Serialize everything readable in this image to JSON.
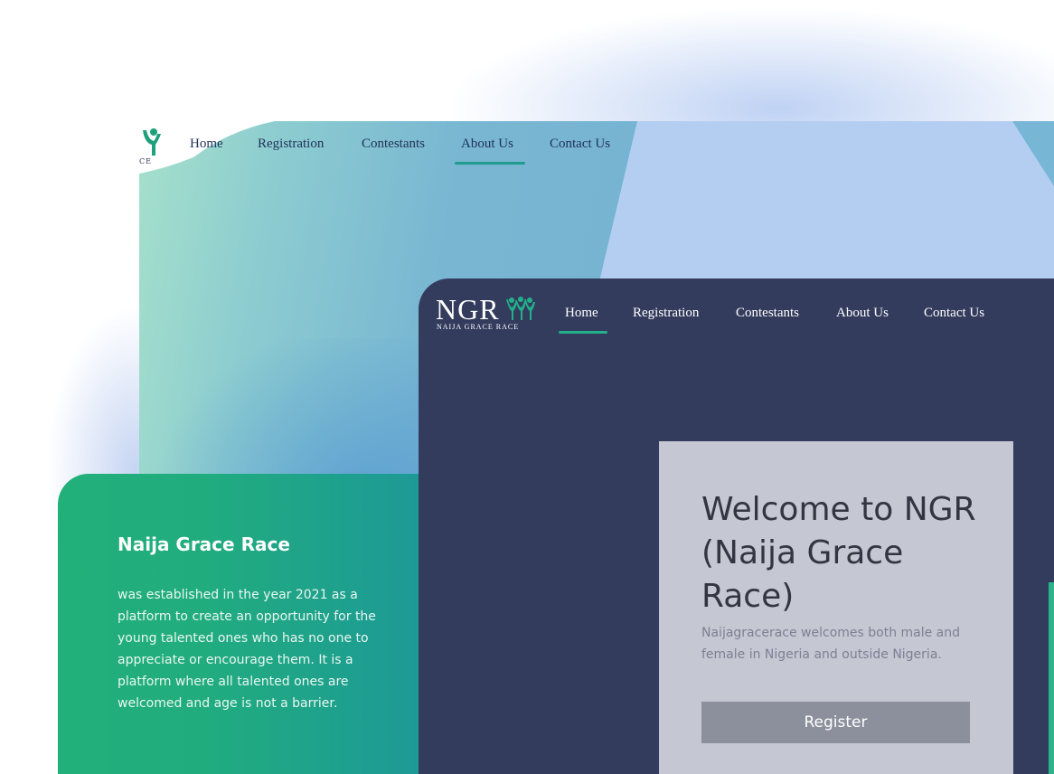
{
  "back_site": {
    "logo_fragment": "CE",
    "nav": [
      "Home",
      "Registration",
      "Contestants",
      "About Us",
      "Contact Us"
    ],
    "active": "About Us"
  },
  "front_site": {
    "logo_text": "NGR",
    "logo_subtitle": "NAIJA GRACE RACE",
    "nav": [
      "Home",
      "Registration",
      "Contestants",
      "About Us",
      "Contact Us"
    ],
    "active": "Home",
    "welcome_title": "Welcome to NGR (Naija Grace Race)",
    "welcome_desc": "Naijagracerace welcomes both male and female in Nigeria and outside Nigeria.",
    "register_label": "Register"
  },
  "info_card": {
    "title": "Naija Grace Race",
    "body": "was established in the year 2021 as a platform to create an opportunity for the young talented ones who has no one to appreciate or encourage them. It is a platform where all talented ones are welcomed and age is not a barrier."
  },
  "colors": {
    "dark_navy": "#343c5e",
    "accent_green": "#22b08a",
    "card_gray": "#c5c7d3",
    "button_gray": "#8b909c"
  }
}
